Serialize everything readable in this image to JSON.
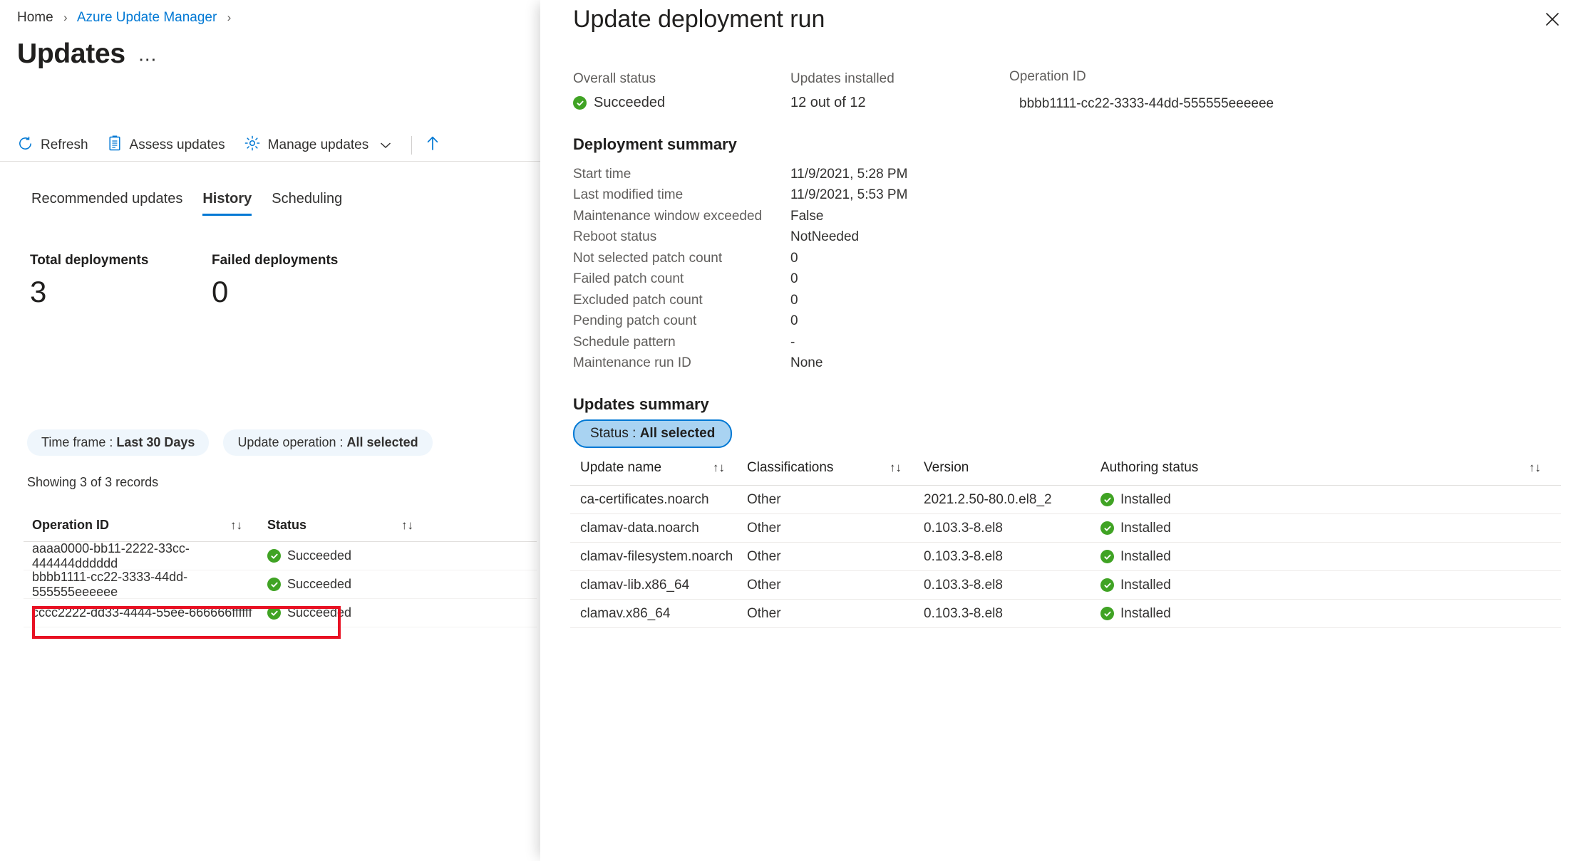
{
  "breadcrumb": {
    "items": [
      "Home",
      "Azure Update Manager"
    ],
    "separator": "›"
  },
  "page": {
    "title": "Updates",
    "more_label": "⋯"
  },
  "toolbar": {
    "refresh_label": "Refresh",
    "assess_label": "Assess updates",
    "manage_label": "Manage updates",
    "manage_chevron": "∨",
    "upload_icon": "upload-arrow-icon"
  },
  "tabs": [
    {
      "label": "Recommended updates",
      "active": false
    },
    {
      "label": "History",
      "active": true
    },
    {
      "label": "Scheduling",
      "active": false
    }
  ],
  "metrics": [
    {
      "label": "Total deployments",
      "value": "3"
    },
    {
      "label": "Failed deployments",
      "value": "0"
    }
  ],
  "filters": [
    {
      "key": "Time frame : ",
      "value": "Last 30 Days"
    },
    {
      "key": "Update operation : ",
      "value": "All selected"
    }
  ],
  "records_note": "Showing 3 of 3 records",
  "history_table": {
    "columns": [
      "Operation ID",
      "Status"
    ],
    "sorter_glyph": "↑↓",
    "rows": [
      {
        "operation_id": "aaaa0000-bb11-2222-33cc-444444dddddd",
        "status": "Succeeded"
      },
      {
        "operation_id": "bbbb1111-cc22-3333-44dd-555555eeeeee",
        "status": "Succeeded"
      },
      {
        "operation_id": "cccc2222-dd33-4444-55ee-666666ffffff",
        "status": "Succeeded"
      }
    ],
    "highlighted_row_index": 1
  },
  "panel": {
    "title": "Update deployment run",
    "close_label": "Close",
    "kpis": [
      {
        "label": "Overall status",
        "value": "Succeeded",
        "has_icon": true
      },
      {
        "label": "Updates installed",
        "value": "12 out of 12",
        "has_icon": false
      },
      {
        "label": "Operation ID",
        "value": "bbbb1111-cc22-3333-44dd-555555eeeeee",
        "has_icon": false
      }
    ],
    "deployment_summary": {
      "heading": "Deployment summary",
      "rows": [
        {
          "key": "Start time",
          "value": "11/9/2021, 5:28 PM"
        },
        {
          "key": "Last modified time",
          "value": "11/9/2021, 5:53 PM"
        },
        {
          "key": "Maintenance window exceeded",
          "value": "False"
        },
        {
          "key": "Reboot status",
          "value": "NotNeeded"
        },
        {
          "key": "Not selected patch count",
          "value": "0"
        },
        {
          "key": "Failed patch count",
          "value": "0"
        },
        {
          "key": "Excluded patch count",
          "value": "0"
        },
        {
          "key": "Pending patch count",
          "value": "0"
        },
        {
          "key": "Schedule pattern",
          "value": "-"
        },
        {
          "key": "Maintenance run ID",
          "value": "None"
        }
      ]
    },
    "updates_summary": {
      "heading": "Updates summary",
      "status_filter": {
        "key": "Status : ",
        "value": "All selected"
      },
      "columns": [
        "Update name",
        "Classifications",
        "Version",
        "Authoring status"
      ],
      "sorter_glyph": "↑↓",
      "rows": [
        {
          "name": "ca-certificates.noarch",
          "classification": "Other",
          "version": "2021.2.50-80.0.el8_2",
          "authoring_status": "Installed"
        },
        {
          "name": "clamav-data.noarch",
          "classification": "Other",
          "version": "0.103.3-8.el8",
          "authoring_status": "Installed"
        },
        {
          "name": "clamav-filesystem.noarch",
          "classification": "Other",
          "version": "0.103.3-8.el8",
          "authoring_status": "Installed"
        },
        {
          "name": "clamav-lib.x86_64",
          "classification": "Other",
          "version": "0.103.3-8.el8",
          "authoring_status": "Installed"
        },
        {
          "name": "clamav.x86_64",
          "classification": "Other",
          "version": "0.103.3-8.el8",
          "authoring_status": "Installed"
        }
      ]
    }
  },
  "colors": {
    "accent": "#0078d4",
    "success": "#40a324",
    "highlight_box": "#e81123",
    "pill_bg": "#eff6fc",
    "panel_pill_bg": "#a9d3f2"
  }
}
